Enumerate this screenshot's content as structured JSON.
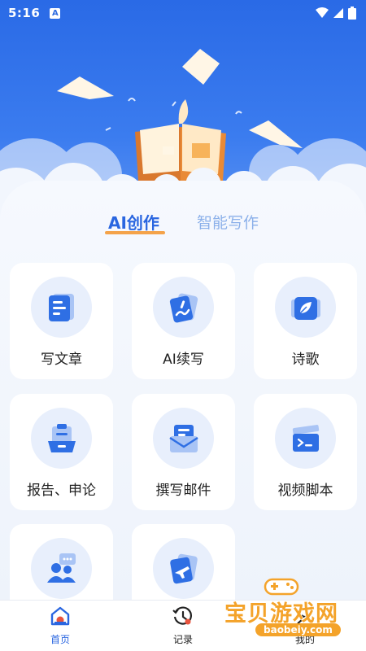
{
  "status_bar": {
    "time": "5:16",
    "notification_icon": "A"
  },
  "tabs": [
    {
      "label": "AI创作",
      "active": true
    },
    {
      "label": "智能写作",
      "active": false
    }
  ],
  "tiles": [
    {
      "label": "写文章",
      "icon": "document-icon"
    },
    {
      "label": "AI续写",
      "icon": "pen-card-icon"
    },
    {
      "label": "诗歌",
      "icon": "leaf-card-icon"
    },
    {
      "label": "报告、申论",
      "icon": "clipboard-icon"
    },
    {
      "label": "撰写邮件",
      "icon": "envelope-icon"
    },
    {
      "label": "视频脚本",
      "icon": "clapperboard-icon"
    },
    {
      "label": "",
      "icon": "people-chat-icon"
    },
    {
      "label": "",
      "icon": "plane-card-icon"
    }
  ],
  "bottom_nav": [
    {
      "label": "首页",
      "icon": "home-icon",
      "active": true
    },
    {
      "label": "记录",
      "icon": "history-icon",
      "active": false
    },
    {
      "label": "我的",
      "icon": "user-icon",
      "active": false
    }
  ],
  "watermark": {
    "text": "宝贝游戏网",
    "url": "baobeiy.com"
  },
  "colors": {
    "primary": "#2a66e0",
    "accent_underline": "#f4a34a",
    "icon_bg": "#e8effc",
    "watermark": "#f4a32a"
  }
}
